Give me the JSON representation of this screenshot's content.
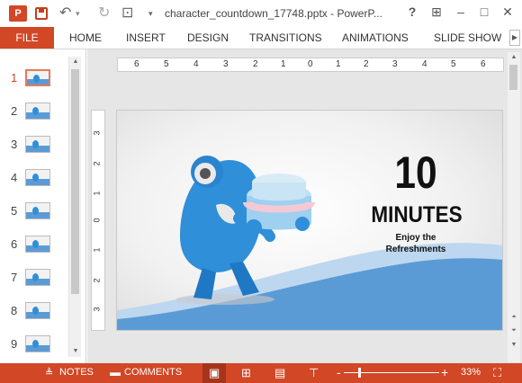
{
  "titlebar": {
    "app_logo": "P",
    "doc_title": "character_countdown_17748.pptx - PowerP...",
    "help": "?",
    "icons": [
      "save-icon",
      "undo-icon",
      "redo-icon",
      "present-icon",
      "ribbon-options-icon",
      "minimize-icon",
      "maximize-icon",
      "close-icon"
    ]
  },
  "tabs": [
    {
      "label": "FILE"
    },
    {
      "label": "HOME"
    },
    {
      "label": "INSERT"
    },
    {
      "label": "DESIGN"
    },
    {
      "label": "TRANSITIONS"
    },
    {
      "label": "ANIMATIONS"
    },
    {
      "label": "SLIDE SHOW"
    }
  ],
  "thumbnails": [
    {
      "num": "1",
      "active": true
    },
    {
      "num": "2"
    },
    {
      "num": "3"
    },
    {
      "num": "4"
    },
    {
      "num": "5"
    },
    {
      "num": "6"
    },
    {
      "num": "7"
    },
    {
      "num": "8"
    },
    {
      "num": "9"
    }
  ],
  "ruler": {
    "horizontal": [
      "6",
      "5",
      "4",
      "3",
      "2",
      "1",
      "0",
      "1",
      "2",
      "3",
      "4",
      "5",
      "6"
    ],
    "vertical": [
      "3",
      "2",
      "1",
      "0",
      "1",
      "2",
      "3"
    ]
  },
  "slide": {
    "number": "10",
    "unit": "MINUTES",
    "line1": "Enjoy the",
    "line2": "Refreshments",
    "colors": {
      "wave_dark": "#5b9bd5",
      "wave_light": "#bcd7ef",
      "character": "#2f8fd9"
    }
  },
  "statusbar": {
    "notes": "NOTES",
    "comments": "COMMENTS",
    "zoom_minus": "-",
    "zoom_plus": "+",
    "zoom_level": "33%",
    "accent": "#d24726"
  }
}
